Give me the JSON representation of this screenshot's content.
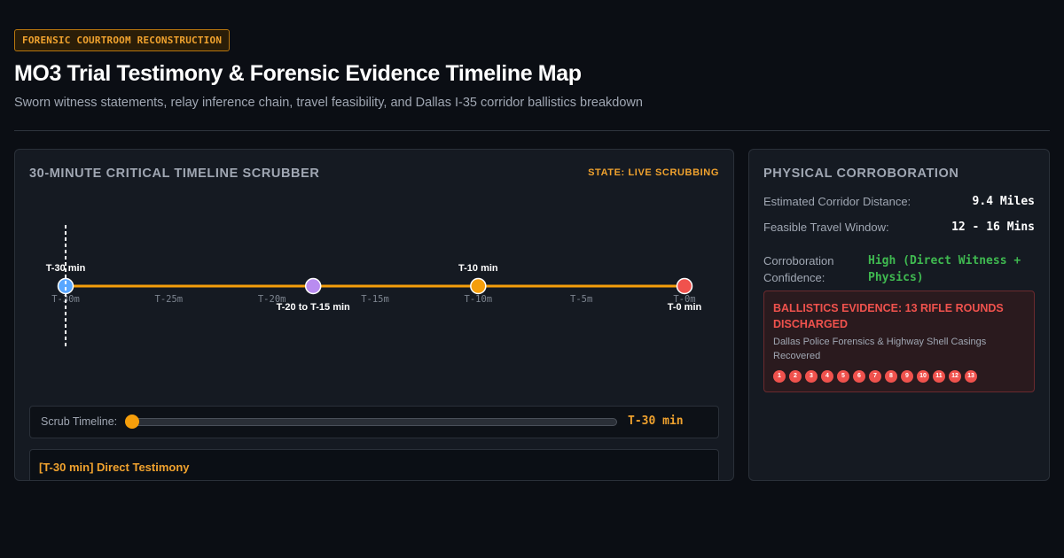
{
  "header": {
    "badge": "FORENSIC COURTROOM RECONSTRUCTION",
    "title": "MO3 Trial Testimony & Forensic Evidence Timeline Map",
    "subtitle": "Sworn witness statements, relay inference chain, travel feasibility, and Dallas I-35 corridor ballistics breakdown"
  },
  "scrubber_panel": {
    "title": "30-MINUTE CRITICAL TIMELINE SCRUBBER",
    "state": "STATE: LIVE SCRUBBING",
    "ticks": [
      "T-30m",
      "T-25m",
      "T-20m",
      "T-15m",
      "T-10m",
      "T-5m",
      "T-0m"
    ],
    "events": [
      {
        "label": "T-30 min",
        "minutes_before": 30,
        "color": "#58a6ff",
        "label_pos": "above"
      },
      {
        "label": "T-20 to T-15 min",
        "minutes_before": 18,
        "color": "#b98cf0",
        "label_pos": "below"
      },
      {
        "label": "T-10 min",
        "minutes_before": 10,
        "color": "#f59e0b",
        "label_pos": "above"
      },
      {
        "label": "T-0 min",
        "minutes_before": 0,
        "color": "#f0524d",
        "label_pos": "below"
      }
    ],
    "scrub": {
      "label": "Scrub Timeline:",
      "current_minutes_before": 30,
      "value_text": "T-30 min"
    },
    "detail_title": "[T-30 min] Direct Testimony"
  },
  "corroboration_panel": {
    "title": "PHYSICAL CORROBORATION",
    "distance_label": "Estimated Corridor Distance:",
    "distance_value": "9.4 Miles",
    "window_label": "Feasible Travel Window:",
    "window_value": "12 - 16 Mins",
    "confidence_label": "Corroboration Confidence:",
    "confidence_value": "High (Direct Witness + Physics)",
    "ballistics": {
      "title": "BALLISTICS EVIDENCE: 13 RIFLE ROUNDS DISCHARGED",
      "subtitle": "Dallas Police Forensics & Highway Shell Casings Recovered",
      "rounds": [
        "1",
        "2",
        "3",
        "4",
        "5",
        "6",
        "7",
        "8",
        "9",
        "10",
        "11",
        "12",
        "13"
      ]
    }
  },
  "colors": {
    "accent": "#f59e0b",
    "danger": "#f0524d",
    "success": "#3fb950"
  }
}
